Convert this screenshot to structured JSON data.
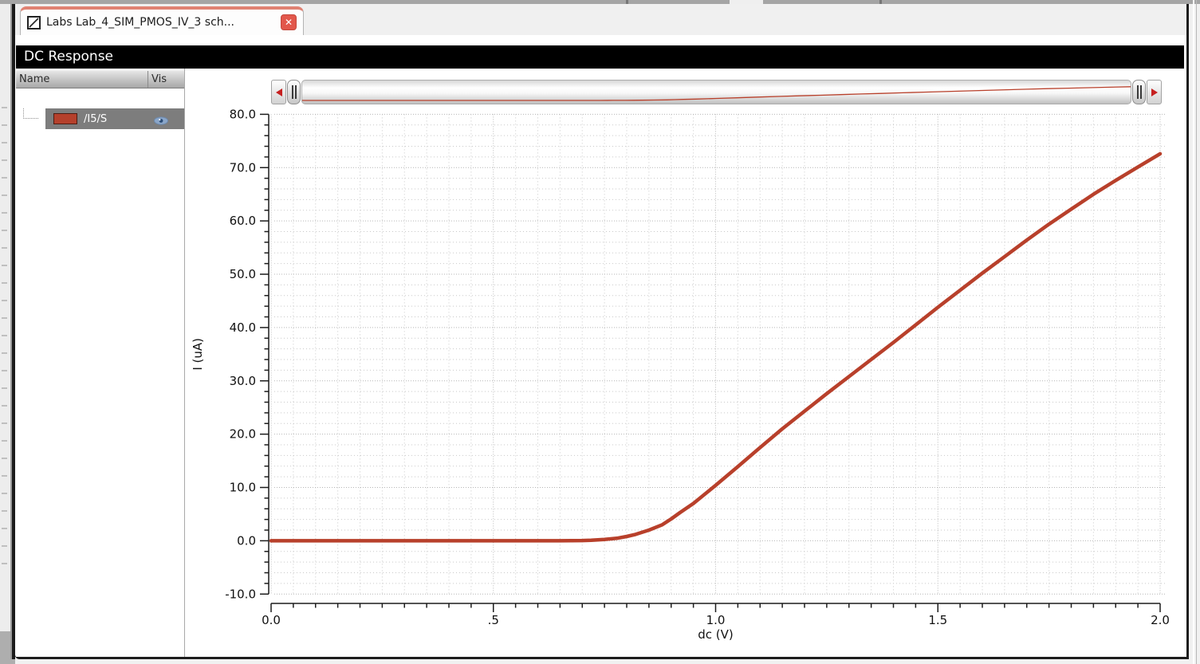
{
  "tab": {
    "label": "Labs Lab_4_SIM_PMOS_IV_3 sch...",
    "close_glyph": "✕",
    "icon": "schematic-icon"
  },
  "titlebar": {
    "title": "DC Response"
  },
  "signal_panel": {
    "columns": [
      "Name",
      "Vis"
    ],
    "rows": [
      {
        "name": "/I5/S",
        "swatch_color": "#b5402c",
        "visible": true
      }
    ]
  },
  "scrollbar": {
    "left_arrow_icon": "left-triangle",
    "right_arrow_icon": "right-triangle"
  },
  "chart_data": {
    "type": "line",
    "title": "DC Response",
    "xlabel": "dc (V)",
    "ylabel": "I (uA)",
    "xlim": [
      0,
      2
    ],
    "ylim": [
      -10,
      80
    ],
    "x_major_ticks": [
      0,
      0.5,
      1.0,
      1.5,
      2.0
    ],
    "x_tick_labels": [
      "0.0",
      ".5",
      "1.0",
      "1.5",
      "2.0"
    ],
    "x_minor_step": 0.05,
    "y_major_ticks": [
      -10,
      0,
      10,
      20,
      30,
      40,
      50,
      60,
      70,
      80
    ],
    "y_tick_labels": [
      "-10.0",
      "0.0",
      "10.0",
      "20.0",
      "30.0",
      "40.0",
      "50.0",
      "60.0",
      "70.0",
      "80.0"
    ],
    "y_minor_step": 2,
    "grid": true,
    "legend_position": "left-panel",
    "series": [
      {
        "name": "/I5/S",
        "color": "#b8402b",
        "x": [
          0,
          0.1,
          0.2,
          0.3,
          0.4,
          0.5,
          0.6,
          0.65,
          0.7,
          0.72,
          0.75,
          0.78,
          0.8,
          0.82,
          0.85,
          0.88,
          0.9,
          0.92,
          0.95,
          1.0,
          1.05,
          1.1,
          1.15,
          1.2,
          1.25,
          1.3,
          1.35,
          1.4,
          1.45,
          1.5,
          1.55,
          1.6,
          1.65,
          1.7,
          1.75,
          1.8,
          1.85,
          1.9,
          1.95,
          2.0
        ],
        "y": [
          0,
          0,
          0,
          0,
          0,
          0,
          0,
          0,
          0.05,
          0.1,
          0.25,
          0.5,
          0.8,
          1.2,
          2.0,
          3.0,
          4.1,
          5.3,
          7.0,
          10.4,
          13.9,
          17.5,
          21.0,
          24.3,
          27.6,
          30.8,
          34.0,
          37.2,
          40.5,
          43.8,
          47.0,
          50.2,
          53.3,
          56.4,
          59.4,
          62.2,
          65.0,
          67.6,
          70.1,
          72.6
        ]
      }
    ]
  },
  "colors": {
    "curve": "#b8402b",
    "tab_accent": "#e08273",
    "close_button": "#e2574b",
    "row_highlight": "#7d7d7d",
    "titlebar_bg": "#000000",
    "grid_dot": "#c9c9c9",
    "axis": "#1c1c1c"
  }
}
